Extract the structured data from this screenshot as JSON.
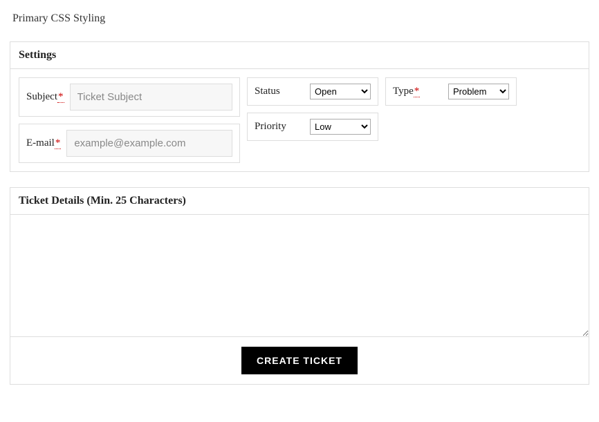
{
  "page_title": "Primary CSS Styling",
  "settings": {
    "header": "Settings",
    "subject": {
      "label": "Subject",
      "required": "*",
      "placeholder": "Ticket Subject"
    },
    "email": {
      "label": "E-mail",
      "required": "*",
      "placeholder": "example@example.com"
    },
    "status": {
      "label": "Status",
      "selected": "Open"
    },
    "priority": {
      "label": "Priority",
      "selected": "Low"
    },
    "type": {
      "label": "Type",
      "required": "*",
      "selected": "Problem"
    }
  },
  "details": {
    "header": "Ticket Details (Min. 25 Characters)"
  },
  "submit_label": "CREATE TICKET"
}
